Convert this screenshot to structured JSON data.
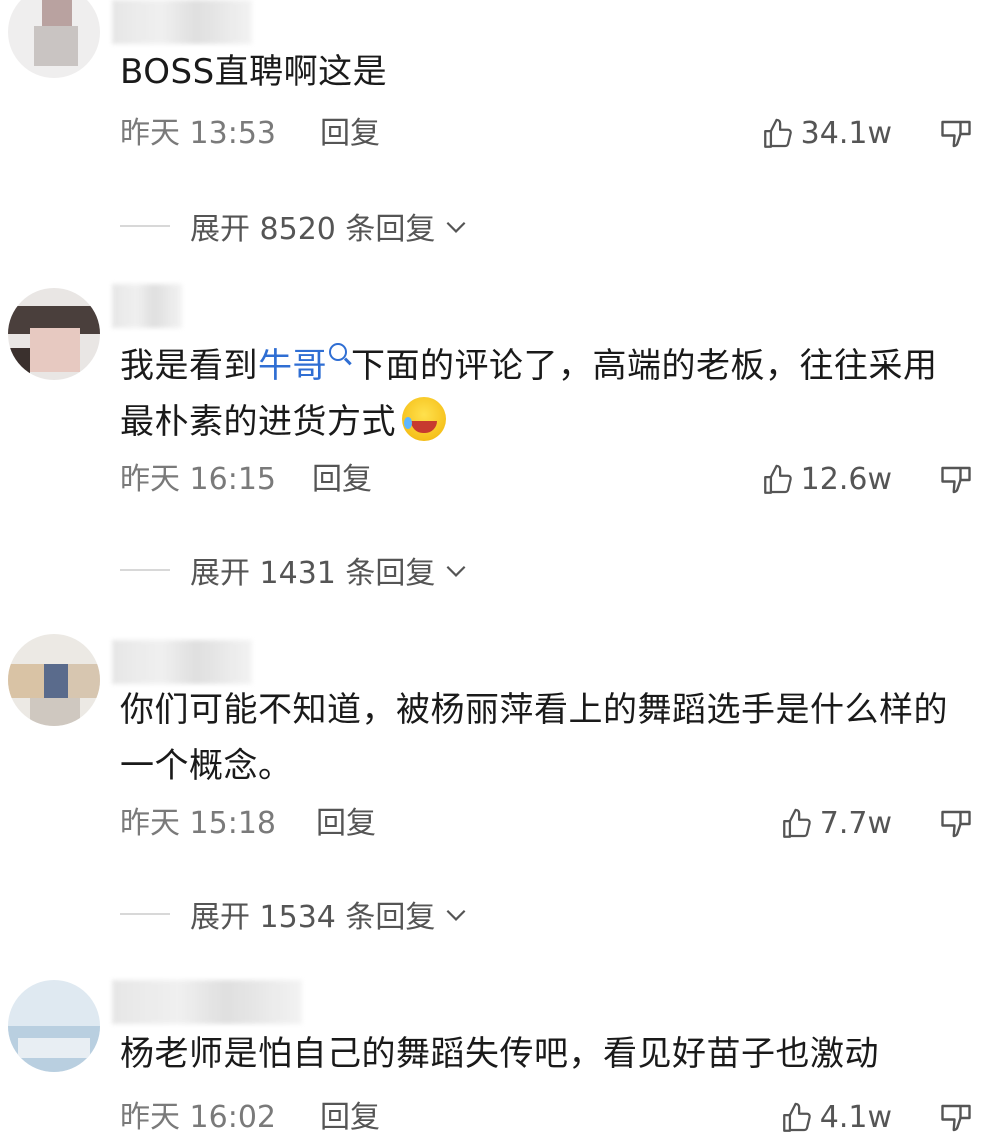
{
  "comments": [
    {
      "text": "BOSS直聘啊这是",
      "time": "昨天 13:53",
      "reply_label": "回复",
      "likes": "34.1w",
      "expand_text": "展开 8520 条回复"
    },
    {
      "text_before": "我是看到",
      "link_text": "牛哥",
      "text_after": "下面的评论了，高端的老板，往往采用最朴素的进货方式",
      "time": "昨天 16:15",
      "reply_label": "回复",
      "likes": "12.6w",
      "expand_text": "展开 1431 条回复"
    },
    {
      "text": "你们可能不知道，被杨丽萍看上的舞蹈选手是什么样的一个概念。",
      "time": "昨天 15:18",
      "reply_label": "回复",
      "likes": "7.7w",
      "expand_text": "展开 1534 条回复"
    },
    {
      "text": "杨老师是怕自己的舞蹈失传吧，看见好苗子也激动",
      "time": "昨天 16:02",
      "reply_label": "回复",
      "likes": "4.1w"
    }
  ],
  "icons": {
    "like": "thumbs-up-icon",
    "dislike": "thumbs-down-icon",
    "expand": "chevron-down-icon",
    "search": "search-icon",
    "emoji": "laughing-crying-emoji"
  },
  "colors": {
    "link": "#2f6ed3",
    "meta": "#7a7a7a"
  }
}
